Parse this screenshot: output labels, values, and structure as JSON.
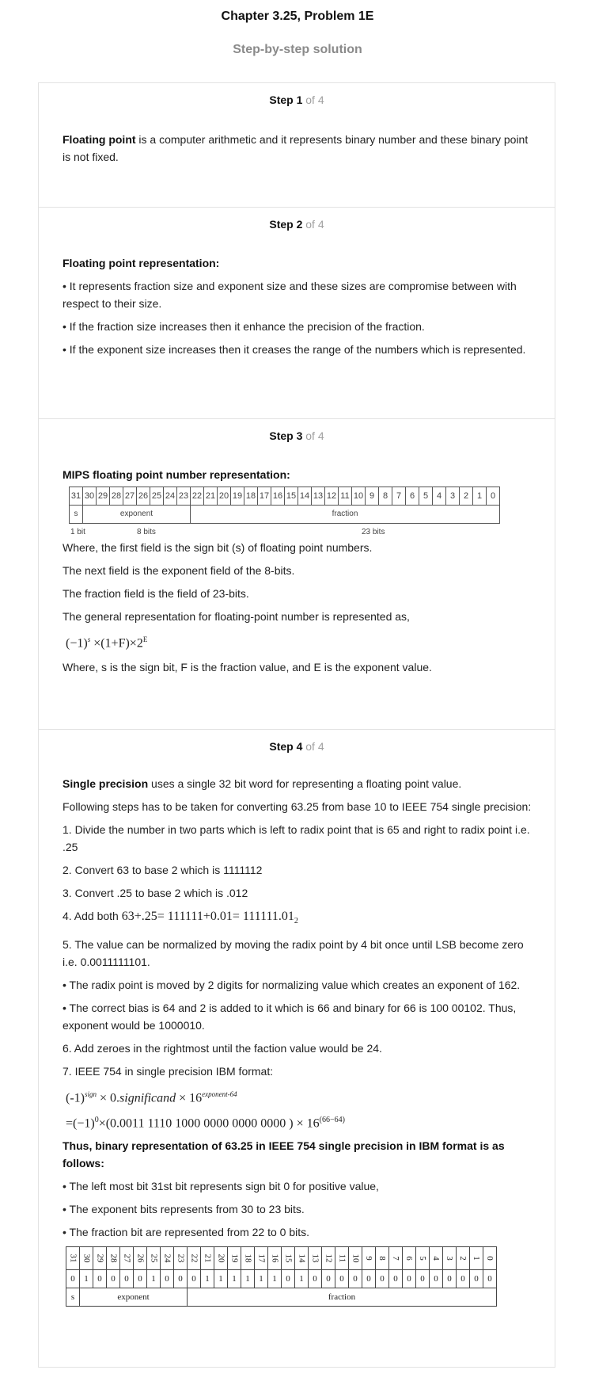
{
  "header": {
    "title": "Chapter 3.25, Problem 1E",
    "subtitle": "Step-by-step solution"
  },
  "steps": [
    {
      "label": "Step 1",
      "of": "of 4",
      "term": "Floating point",
      "text": " is a computer arithmetic and it represents binary number and these binary point is not fixed."
    },
    {
      "label": "Step 2",
      "of": "of 4",
      "heading": "Floating point representation:",
      "bullets": [
        "• It represents fraction size and exponent size and these sizes are compromise between with respect to their size.",
        "• If the fraction size increases then it enhance the precision of the fraction.",
        "• If the exponent size increases then it creases the range of the numbers which is represented."
      ]
    },
    {
      "label": "Step 3",
      "of": "of 4",
      "heading": "MIPS floating point number representation:",
      "mips_bits": [
        "31",
        "30",
        "29",
        "28",
        "27",
        "26",
        "25",
        "24",
        "23",
        "22",
        "21",
        "20",
        "19",
        "18",
        "17",
        "16",
        "15",
        "14",
        "13",
        "12",
        "11",
        "10",
        "9",
        "8",
        "7",
        "6",
        "5",
        "4",
        "3",
        "2",
        "1",
        "0"
      ],
      "mips_fields": {
        "sign": "s",
        "exponent": "exponent",
        "fraction": "fraction"
      },
      "mips_sizes": {
        "sign": "1 bit",
        "exponent": "8 bits",
        "fraction": "23 bits"
      },
      "lines": [
        "Where, the first field is the sign bit (s) of floating point numbers.",
        "The next field is the exponent field of the 8-bits.",
        "The fraction field is the field of 23-bits.",
        "The general representation for floating-point number is represented as,"
      ],
      "formula": "(−1)",
      "formula_sup": "s",
      "formula_rest": " ×(1+F)×2",
      "formula_sup2": "E",
      "closing": "Where, s is the sign bit, F is the fraction value, and E is the exponent value."
    },
    {
      "label": "Step 4",
      "of": "of 4",
      "term": "Single precision",
      "intro": " uses a single 32 bit word for representing a floating point value.",
      "para1": "Following steps has to be taken for converting 63.25 from base 10 to IEEE 754 single precision:",
      "item1": "1. Divide the number in two parts which is left to radix point that is 65 and right to radix point i.e. .25",
      "item2": "2. Convert 63 to base 2 which is 1111112",
      "item3": "3. Convert .25 to base 2 which is .012",
      "item4_prefix": "4. Add both ",
      "item4_math": "63+.25= 111111+0.01= 111111.01",
      "item4_sub": "2",
      "item5": "5. The value can be normalized by moving the radix point by 4 bit once until LSB become zero i.e. 0.0011111101.",
      "bullet1": "• The radix point is moved by 2 digits for normalizing value which creates an exponent of 162.",
      "bullet2": "• The correct bias is 64 and 2 is added to it which is 66 and binary for 66 is 100 00102. Thus, exponent would be 1000010.",
      "item6": "6. Add zeroes in the rightmost until the faction value would be 24.",
      "item7": "7. IEEE 754 in single precision IBM format:",
      "eq1_a": "(-1)",
      "eq1_sup": "sign",
      "eq1_b": " × 0.",
      "eq1_c": "significand",
      "eq1_d": " × 16",
      "eq1_sup2": "exponent-64",
      "eq2_a": "=(−1)",
      "eq2_sup": "0",
      "eq2_b": "×(0.0011 1110 1000 0000 0000 0000 ) × 16",
      "eq2_sup2": "(66−64)",
      "conclusion": "Thus, binary representation of 63.25 in IEEE 754 single precision in IBM format is as follows:",
      "final_bullets": [
        "• The left most bit 31st bit represents sign bit 0 for positive value,",
        "• The exponent bits represents from 30 to 23 bits.",
        "• The fraction bit are represented from 22 to 0 bits."
      ],
      "ibm_nums": [
        "31",
        "30",
        "29",
        "28",
        "27",
        "26",
        "25",
        "24",
        "23",
        "22",
        "21",
        "20",
        "19",
        "18",
        "17",
        "16",
        "15",
        "14",
        "13",
        "12",
        "11",
        "10",
        "9",
        "8",
        "7",
        "6",
        "5",
        "4",
        "3",
        "2",
        "1",
        "0"
      ],
      "ibm_bits": [
        "0",
        "1",
        "0",
        "0",
        "0",
        "0",
        "1",
        "0",
        "0",
        "0",
        "1",
        "1",
        "1",
        "1",
        "1",
        "1",
        "0",
        "1",
        "0",
        "0",
        "0",
        "0",
        "0",
        "0",
        "0",
        "0",
        "0",
        "0",
        "0",
        "0",
        "0",
        "0"
      ],
      "ibm_fields": {
        "sign": "s",
        "exponent": "exponent",
        "fraction": "fraction"
      }
    }
  ]
}
